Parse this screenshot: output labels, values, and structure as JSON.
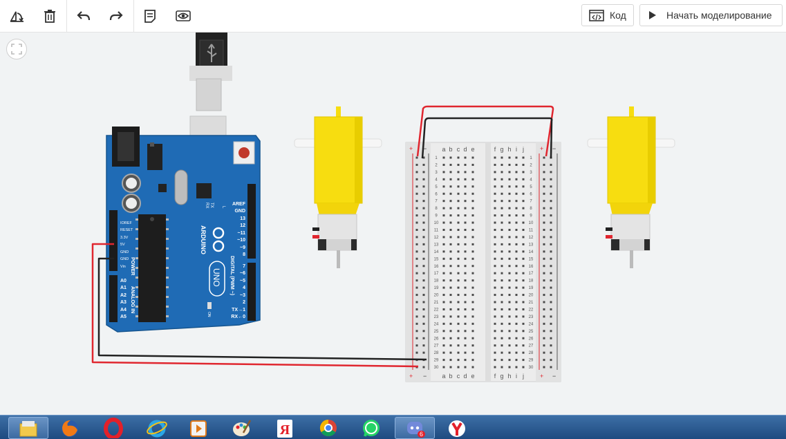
{
  "toolbar": {
    "rotate_icon": "rotate-icon",
    "delete_icon": "trash-icon",
    "undo_icon": "undo-icon",
    "redo_icon": "redo-icon",
    "notes_icon": "notes-icon",
    "view_icon": "eye-icon",
    "code_label": "Код",
    "simulate_label": "Начать моделирование"
  },
  "arduino": {
    "brand": "ARDUINO",
    "model": "UNO",
    "power_label": "POWER",
    "analog_label": "ANALOG IN",
    "digital_label": "DIGITAL (PWM ~)",
    "on_label": "ON",
    "l_label": "L",
    "tx_label": "TX",
    "rx_label": "RX",
    "power_pins": [
      "IOREF",
      "RESET",
      "3.3V",
      "5V",
      "GND",
      "GND",
      "Vin"
    ],
    "analog_pins": [
      "A0",
      "A1",
      "A2",
      "A3",
      "A4",
      "A5"
    ],
    "digital_pins": [
      "AREF",
      "GND",
      "13",
      "12",
      "~11",
      "~10",
      "~9",
      "8",
      "7",
      "~6",
      "~5",
      "4",
      "~3",
      "2",
      "TX→1",
      "RX←0"
    ]
  },
  "breadboard": {
    "letters_left": [
      "a",
      "b",
      "c",
      "d",
      "e"
    ],
    "letters_right": [
      "f",
      "g",
      "h",
      "i",
      "j"
    ],
    "rows": 30,
    "plus": "+",
    "minus": "−"
  },
  "taskbar": {
    "apps": [
      "explorer",
      "firefox",
      "opera",
      "internet-explorer",
      "media-player",
      "paint",
      "yandex",
      "chrome",
      "whatsapp",
      "discord",
      "yandex-browser"
    ],
    "discord_badge": "6"
  },
  "colors": {
    "wire_red": "#e0262f",
    "wire_black": "#222222",
    "board_blue": "#1f6bb5",
    "motor_yellow": "#f7dd10"
  }
}
